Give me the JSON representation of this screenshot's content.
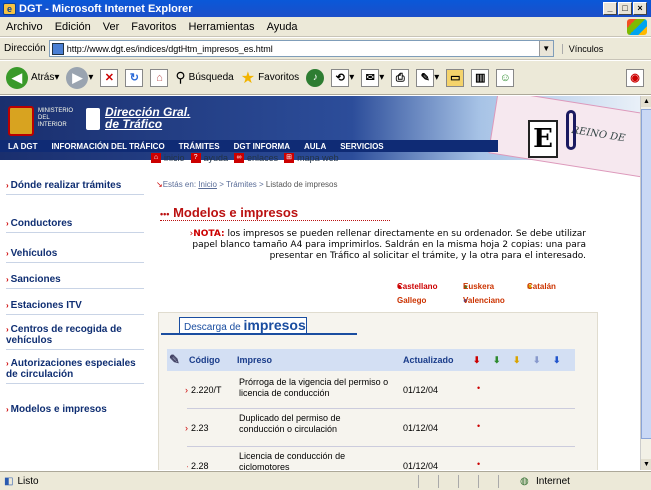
{
  "window": {
    "title": "DGT - Microsoft Internet Explorer",
    "controls": [
      "_",
      "□",
      "×"
    ]
  },
  "menu": [
    "Archivo",
    "Edición",
    "Ver",
    "Favoritos",
    "Herramientas",
    "Ayuda"
  ],
  "address": {
    "label": "Dirección",
    "url": "http://www.dgt.es/indices/dgtHtm_impresos_es.html",
    "links_label": "Vínculos"
  },
  "toolbar": {
    "back": "Atrás",
    "search": "Búsqueda",
    "favorites": "Favoritos"
  },
  "site": {
    "ministry": "MINISTERIO DEL INTERIOR",
    "brand_line1": "Dirección Gral.",
    "brand_line2": "de Tráfico",
    "banner_text": "REINO DE",
    "nav": [
      "LA DGT",
      "INFORMACIÓN DEL TRÁFICO",
      "TRÁMITES",
      "DGT INFORMA",
      "AULA",
      "SERVICIOS"
    ],
    "subnav": [
      "inicio",
      "ayuda",
      "enlaces",
      "mapa web"
    ],
    "sidebar": [
      "Dónde realizar trámites",
      "Conductores",
      "Vehículos",
      "Sanciones",
      "Estaciones ITV",
      "Centros de recogida de vehículos",
      "Autorizaciones especiales de circulación",
      "Modelos e impresos"
    ],
    "breadcrumb": {
      "prefix": "Estás en: ",
      "home": "Inicio",
      "sep": " > ",
      "section": "Trámites",
      "current": "Listado de impresos"
    },
    "page_title": "Modelos e impresos",
    "note_label": "NOTA:",
    "note_text": " los impresos se pueden rellenar directamente en su ordenador. Se debe utilizar papel blanco tamaño A4 para imprimirlos. Saldrán en la misma hoja 2 copias: una para presentar en Tráfico al solicitar el trámite, y la otra para el interesado.",
    "languages": [
      {
        "label": "Castellano",
        "color": "#cc0000"
      },
      {
        "label": "Euskera",
        "color": "#2e8b2e"
      },
      {
        "label": "Catalán",
        "color": "#d9a400"
      },
      {
        "label": "Gallego",
        "color": "#8899cc"
      },
      {
        "label": "Valenciano",
        "color": "#2255cc"
      }
    ],
    "download": {
      "prefix": "Descarga de ",
      "strong": "impresos"
    },
    "table": {
      "headers": [
        "Código",
        "Impreso",
        "Actualizado"
      ],
      "rows": [
        {
          "code": "2.220/T",
          "name": "Prórroga de la vigencia del permiso o licencia de conducción",
          "date": "01/12/04"
        },
        {
          "code": "2.23",
          "name": "Duplicado del permiso de conducción o circulación",
          "date": "01/12/04"
        },
        {
          "code": "2.28",
          "name": "Licencia de conducción de ciclomotores",
          "date": "01/12/04"
        }
      ]
    }
  },
  "status": {
    "left": "Listo",
    "zone": "Internet"
  }
}
